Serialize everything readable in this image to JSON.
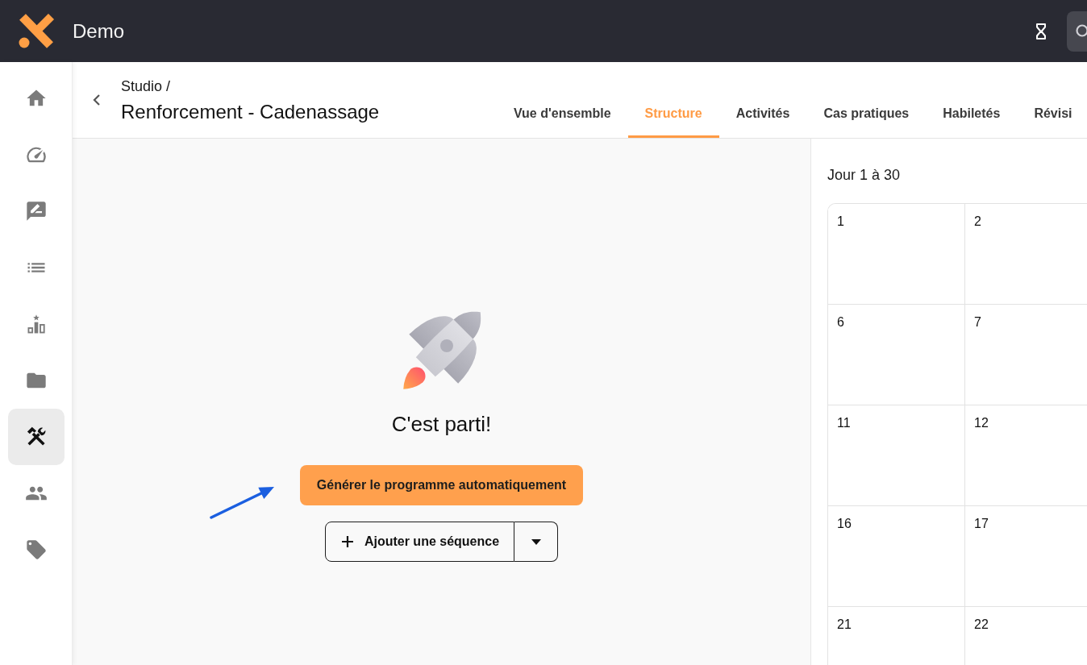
{
  "app_bar": {
    "title": "Demo"
  },
  "sidebar": {
    "items": [
      {
        "selected": false
      },
      {
        "selected": false
      },
      {
        "selected": false
      },
      {
        "selected": false
      },
      {
        "selected": false
      },
      {
        "selected": false
      },
      {
        "selected": true
      },
      {
        "selected": false
      },
      {
        "selected": false
      }
    ]
  },
  "header": {
    "breadcrumb": "Studio /",
    "title": "Renforcement - Cadenassage",
    "tabs": [
      {
        "label": "Vue d'ensemble",
        "selected": false
      },
      {
        "label": "Structure",
        "selected": true
      },
      {
        "label": "Activités",
        "selected": false
      },
      {
        "label": "Cas pratiques",
        "selected": false
      },
      {
        "label": "Habiletés",
        "selected": false
      },
      {
        "label": "Révisi",
        "selected": false
      }
    ]
  },
  "empty_state": {
    "heading": "C'est parti!",
    "primary_button": "Générer le programme automatiquement",
    "add_button": "Ajouter une séquence"
  },
  "calendar": {
    "range": "Jour 1 à 30",
    "rows": [
      [
        "1",
        "2"
      ],
      [
        "6",
        "7"
      ],
      [
        "11",
        "12"
      ],
      [
        "16",
        "17"
      ],
      [
        "21",
        "22"
      ]
    ]
  }
}
